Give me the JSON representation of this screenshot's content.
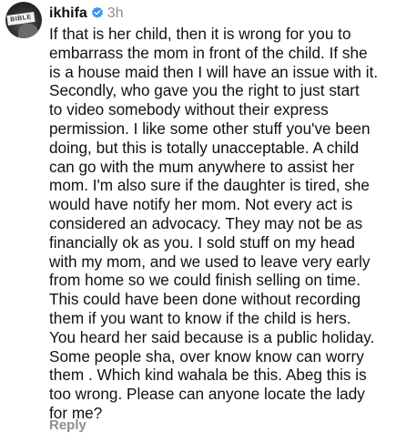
{
  "comment": {
    "username": "ikhifa",
    "time": "3h",
    "avatar_text": "BIBLE",
    "lines": [
      "If that is her child, then it is wrong for you to",
      "embarrass the mom in front of the child. If she",
      "is a house maid then I will have an issue with it.",
      "Secondly, who gave you the right to just start",
      "to video somebody without their express",
      "permission.  I like some other stuff you've been",
      "doing, but this is totally unacceptable.  A child",
      "can go with the mum anywhere to assist her",
      "mom. I'm also sure if the daughter is tired, she",
      "would have notify her mom. Not every act is",
      "considered an advocacy.  They may not be as",
      "financially ok as you. I sold stuff on my head",
      "with my mom, and we used to leave very early",
      "from home so we could finish selling on time.",
      "This could have been done without  recording",
      "them if you want to know if the child is hers.",
      "You heard her said because is a public holiday.",
      "Some people sha,  over know know can worry",
      "them . Which kind wahala be this. Abeg this is",
      "too wrong.  Please can anyone locate the lady",
      "for me?"
    ],
    "reply_label": "Reply"
  },
  "colors": {
    "text": "#111111",
    "secondary": "#8e8e8e",
    "verified": "#3897f0"
  },
  "icons": {
    "verified": "verified-badge-icon"
  }
}
